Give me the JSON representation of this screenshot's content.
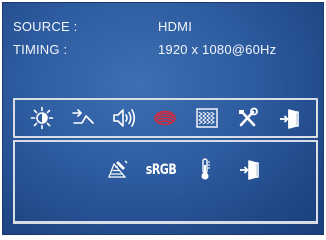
{
  "info": {
    "source_label": "SOURCE :",
    "source_value": "HDMI",
    "timing_label": "TIMING :",
    "timing_value": "1920 x 1080@60Hz"
  },
  "main_menu": {
    "items": [
      {
        "icon": "brightness-contrast-icon",
        "selected": false
      },
      {
        "icon": "input-source-icon",
        "selected": false
      },
      {
        "icon": "audio-speaker-icon",
        "selected": false
      },
      {
        "icon": "color-icon",
        "selected": true
      },
      {
        "icon": "picture-quality-icon",
        "selected": false
      },
      {
        "icon": "tools-setup-icon",
        "selected": false
      },
      {
        "icon": "exit-icon",
        "selected": false
      }
    ]
  },
  "sub_menu": {
    "items": [
      {
        "icon": "color-temperature-user-icon"
      },
      {
        "icon": "srgb-icon",
        "text": "sRGB"
      },
      {
        "icon": "thermometer-icon"
      },
      {
        "icon": "exit-icon"
      }
    ]
  },
  "colors": {
    "background": "#2d5b9f",
    "text": "#f2f5fb",
    "selected_icon": "#d42a3a",
    "border": "#d8dde6"
  }
}
